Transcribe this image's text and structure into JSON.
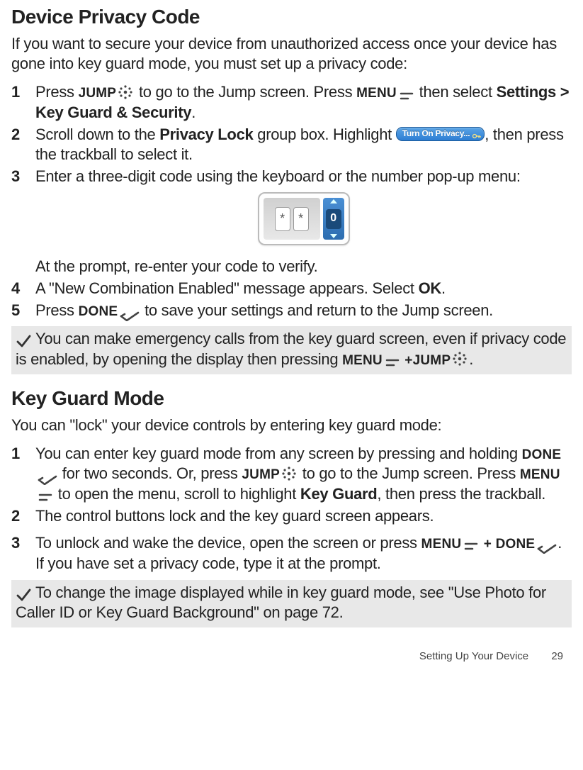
{
  "section1": {
    "title": "Device Privacy Code",
    "intro": "If you want to secure your device from unauthorized access once your device has gone into key guard mode, you must set up a privacy code:",
    "steps": {
      "s1": {
        "num": "1",
        "t1": "Press ",
        "jump": "JUMP",
        "t2": " to go to the Jump screen. Press ",
        "menu": "MENU",
        "t3": " then select ",
        "path": "Settings > Key Guard & Security",
        "t4": "."
      },
      "s2": {
        "num": "2",
        "t1": "Scroll down to the ",
        "b1": "Privacy Lock",
        "t2": " group box. Highlight ",
        "btn": "Turn On Privacy...",
        "t3": ", then press the trackball to select it."
      },
      "s3": {
        "num": "3",
        "t1": "Enter a three-digit code using the keyboard or the number pop-up menu:",
        "popup": {
          "cell1": "*",
          "cell2": "*",
          "spinner": "0"
        },
        "cont": "At the prompt, re-enter your code to verify."
      },
      "s4": {
        "num": "4",
        "t1": "A \"New Combination Enabled\" message appears. Select ",
        "b1": "OK",
        "t2": "."
      },
      "s5": {
        "num": "5",
        "t1": "Press ",
        "done": "DONE",
        "t2": " to save your settings and return to the Jump screen."
      }
    },
    "tip": {
      "t1": "You can make emergency calls from the key guard screen, even if privacy code is enabled, by opening the display then pressing ",
      "menu": "MENU",
      "plus": " +",
      "jump": "JUMP",
      "t2": "."
    }
  },
  "section2": {
    "title": "Key Guard Mode",
    "intro": "You can \"lock\" your device controls by entering key guard mode:",
    "steps": {
      "s1": {
        "num": "1",
        "t1": "You can enter key guard mode from any screen by pressing and holding ",
        "done": "DONE",
        "t2": " for two seconds. Or, press ",
        "jump": "JUMP",
        "t3": " to go to the Jump screen. Press ",
        "menu": "MENU",
        "t4": " to open the menu, scroll to highlight ",
        "b1": "Key Guard",
        "t5": ", then press the trackball."
      },
      "s2": {
        "num": "2",
        "t1": "The control buttons lock and the key guard screen appears."
      },
      "s3": {
        "num": "3",
        "t1": "To unlock and wake the device, open the screen or press ",
        "menu": "MENU",
        "plus": " + ",
        "done": "DONE",
        "t2": ". If you have set a privacy code, type it at the prompt."
      }
    },
    "tip": {
      "t1": "To change the image displayed while in key guard mode, see \"Use Photo for Caller ID or Key Guard Background\" on page 72."
    }
  },
  "footer": {
    "label": "Setting Up Your Device",
    "page": "29"
  }
}
